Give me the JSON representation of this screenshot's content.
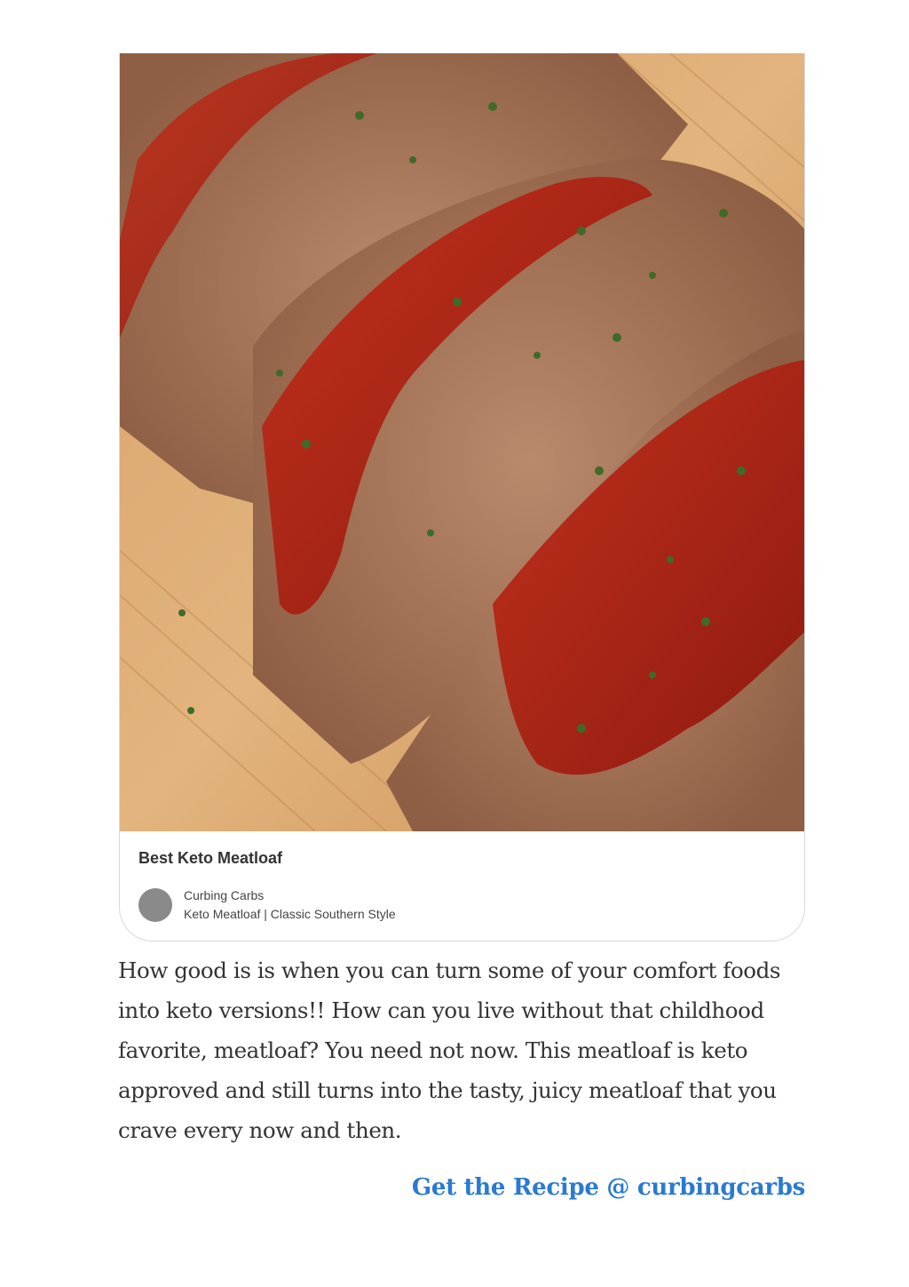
{
  "pin_card": {
    "title": "Best Keto Meatloaf",
    "author_name": "Curbing Carbs",
    "board_name": "Keto Meatloaf | Classic Southern Style",
    "image_icon": "meatloaf-photo"
  },
  "article": {
    "paragraph": "How good is is when you can turn some of your comfort foods into keto versions!! How can you live without that childhood favorite, meatloaf? You need not now. This meatloaf is keto approved and still turns into the tasty, juicy meatloaf that you crave every now and then.",
    "cta_label": "Get the Recipe @ curbingcarbs"
  },
  "colors": {
    "cta": "#2a7ad2",
    "text": "#333333"
  }
}
